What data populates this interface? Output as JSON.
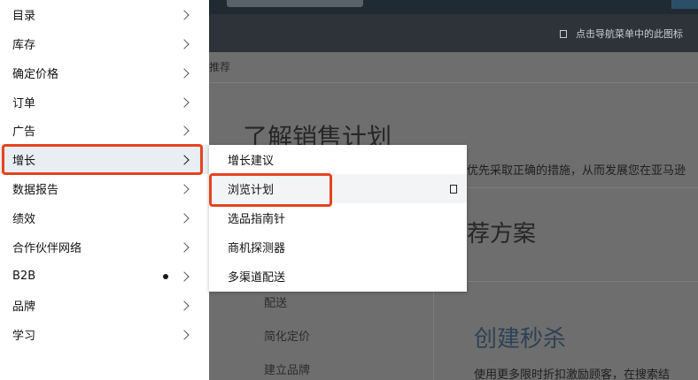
{
  "background": {
    "hint": "点击导航菜单中的此图标",
    "breadcrumb": "推荐",
    "page_title": "了解销售计划",
    "description": "优先采取正确的措施，从而发展您在亚马逊",
    "section_title": "荐方案",
    "side_links": [
      "配送",
      "简化定价",
      "建立品牌"
    ],
    "promo_title": "创建秒杀",
    "promo_description": "使用更多限时折扣激励顾客，在搜索结"
  },
  "menu": {
    "items": [
      {
        "label": "目录"
      },
      {
        "label": "库存"
      },
      {
        "label": "确定价格"
      },
      {
        "label": "订单"
      },
      {
        "label": "广告"
      },
      {
        "label": "增长"
      },
      {
        "label": "数据报告"
      },
      {
        "label": "绩效"
      },
      {
        "label": "合作伙伴网络"
      },
      {
        "label": "B2B"
      },
      {
        "label": "品牌"
      },
      {
        "label": "学习"
      }
    ]
  },
  "submenu": {
    "items": [
      {
        "label": "增长建议"
      },
      {
        "label": "浏览计划"
      },
      {
        "label": "选品指南针"
      },
      {
        "label": "商机探测器"
      },
      {
        "label": "多渠道配送"
      }
    ]
  },
  "colors": {
    "highlight": "#e5431f",
    "menu_bg": "#ffffff",
    "overlay": "#6e6e6e"
  }
}
